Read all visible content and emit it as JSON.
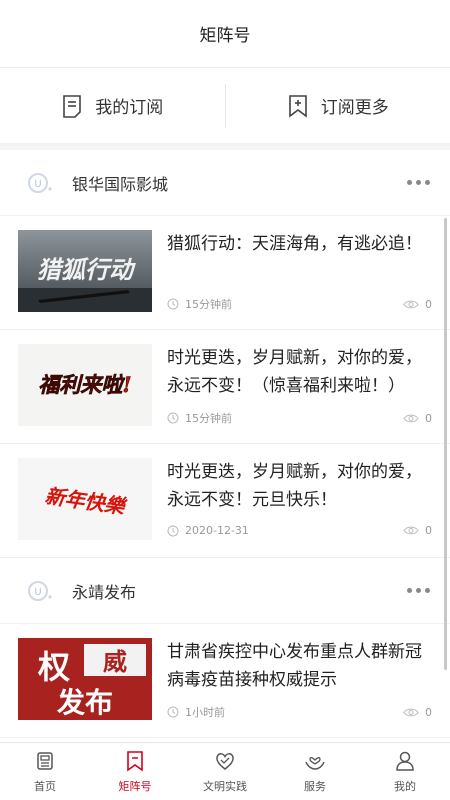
{
  "header": {
    "title": "矩阵号"
  },
  "subscriptions": {
    "my_label": "我的订阅",
    "more_label": "订阅更多"
  },
  "channels": [
    {
      "name": "银华国际影城",
      "articles": [
        {
          "title": "猎狐行动：天涯海角，有逃必追！",
          "time": "15分钟前",
          "views": "0",
          "thumb_text": "猎狐行动"
        },
        {
          "title": "时光更迭，岁月赋新，对你的爱，永远不变！（惊喜福利来啦！）",
          "time": "15分钟前",
          "views": "0",
          "thumb_text": "福利来啦!"
        },
        {
          "title": "时光更迭，岁月赋新，对你的爱，永远不变！元旦快乐！",
          "time": "2020-12-31",
          "views": "0",
          "thumb_text": "新年快樂"
        }
      ]
    },
    {
      "name": "永靖发布",
      "articles": [
        {
          "title": "甘肃省疾控中心发布重点人群新冠病毒疫苗接种权威提示",
          "time": "1小时前",
          "views": "0",
          "thumb_text_1": "权",
          "thumb_text_2": "威",
          "thumb_text_3": "发布"
        }
      ]
    }
  ],
  "tabs": [
    {
      "label": "首页",
      "icon": "home-icon"
    },
    {
      "label": "矩阵号",
      "icon": "bookmark-icon",
      "active": true
    },
    {
      "label": "文明实践",
      "icon": "heart-icon"
    },
    {
      "label": "服务",
      "icon": "hands-icon"
    },
    {
      "label": "我的",
      "icon": "user-icon"
    }
  ],
  "colors": {
    "accent": "#d0021b",
    "text": "#222222",
    "muted": "#999999"
  }
}
